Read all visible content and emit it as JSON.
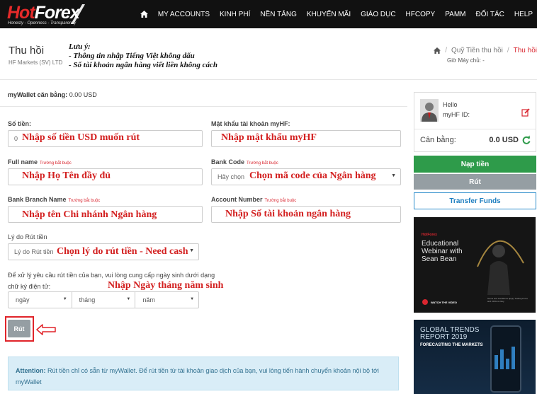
{
  "nav": {
    "logo_hot": "Hot",
    "logo_forex": "Forex",
    "logo_tagline": "Honesty - Openness - Transparency",
    "items": [
      {
        "label": "MY ACCOUNTS"
      },
      {
        "label": "KINH PHÍ"
      },
      {
        "label": "NỀN TẢNG"
      },
      {
        "label": "KHUYẾN MÃI"
      },
      {
        "label": "GIÁO DỤC"
      },
      {
        "label": "HFCOPY"
      },
      {
        "label": "PAMM"
      },
      {
        "label": "ĐỐI TÁC"
      },
      {
        "label": "HELP"
      }
    ],
    "home_icon": "home-icon"
  },
  "header": {
    "title": "Thu hồi",
    "subtitle": "HF Markets (SV) LTD",
    "note_lines": [
      "Lưu ý:",
      "- Thông tin nhập Tiếng Việt không dấu",
      "- Số tài khoản ngân hàng viết liền không cách"
    ],
    "breadcrumb": [
      {
        "label": "Quỹ Tiền thu hồi"
      },
      {
        "label": "Thu hồi"
      }
    ],
    "server_time": "Giờ Máy chủ: -"
  },
  "form": {
    "wallet_label": "myWallet căn bằng:",
    "wallet_value": "0.00 USD",
    "required_tag": "Trường bắt buộc",
    "amount": {
      "label": "Số tiền:",
      "value": "0",
      "hint": "Nhập số tiền USD muốn rút"
    },
    "password": {
      "label": "Mật khẩu tài khoản myHF:",
      "value": "",
      "hint": "Nhập mật khẩu myHF"
    },
    "full_name": {
      "label": "Full name",
      "value": "",
      "hint": "Nhập Họ Tên đầy đủ"
    },
    "bank_code": {
      "label": "Bank Code",
      "selected": "Hãy chọn",
      "hint": "Chọn mã code của Ngân hàng"
    },
    "branch": {
      "label": "Bank Branch Name",
      "value": "",
      "hint": "Nhập tên Chi nhánh Ngân hàng"
    },
    "account_number": {
      "label": "Account Number",
      "value": "",
      "hint": "Nhập Số tài khoản ngân hàng"
    },
    "reason": {
      "label": "Lý do Rút tiền",
      "selected": "Lý do Rút tiền",
      "hint": "Chọn lý do rút tiền - Need cash"
    },
    "dob": {
      "label": "Để xử lý yêu cầu rút tiền của bạn, vui lòng cung cấp ngày sinh dưới dạng chữ ký điện tử:",
      "hint": "Nhập Ngày tháng năm sinh",
      "day": "ngày",
      "month": "tháng",
      "year": "năm"
    },
    "submit_label": "Rút",
    "arrow_icon": "left-arrow-icon"
  },
  "attention": {
    "title": "Attention:",
    "text": "Rút tiền chỉ có sẵn từ myWallet. Để rút tiền từ tài khoản giao dịch của bạn, vui lòng tiến hành chuyển khoản nội bộ tới myWallet"
  },
  "sidebar": {
    "hello": "Hello",
    "myhf_id": "myHF ID:",
    "balance_label": "Cân bằng:",
    "balance_value": "0.0 USD",
    "deposit_label": "Nạp tiền",
    "withdraw_label": "Rút",
    "transfer_label": "Transfer Funds",
    "accent_green": "#2e9b4a",
    "accent_red": "#d9262f"
  },
  "ads": {
    "ad1_brand": "HotForex",
    "ad1_title": "Educational Webinar with Sean Bean",
    "ad1_button": "WATCH THE VIDEO",
    "ad1_fine": "Terms and Conditions apply. Trading Forex and CFDs is risky.",
    "ad2_title": "GLOBAL TRENDS REPORT 2019",
    "ad2_subtitle": "FORECASTING THE MARKETS"
  }
}
